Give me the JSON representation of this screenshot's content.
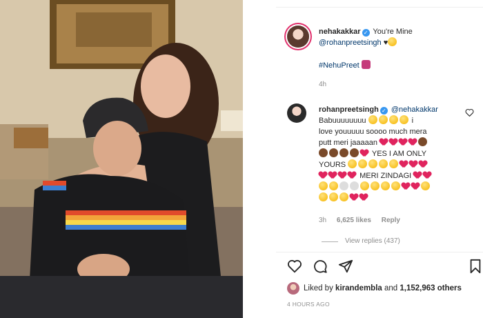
{
  "post": {
    "author": "nehakakkar",
    "caption": "You're Mine",
    "mention": "@rohanpreetsingh",
    "hashtag": "#NehuPreet",
    "time": "4h"
  },
  "comment": {
    "author": "rohanpreetsingh",
    "mention": "@nehakakkar",
    "line1": "Babuuuuuuuu",
    "line2": "i",
    "line3": "love youuuuu soooo much mera",
    "line4": "putt meri jaaaaan",
    "line5": "YES I AM ONLY",
    "line6": "YOURS",
    "line7": "MERI ZINDAGI",
    "time": "3h",
    "likes": "6,625 likes",
    "reply": "Reply",
    "view_replies": "View replies (437)"
  },
  "footer": {
    "liked_prefix": "Liked by",
    "liked_user": "kirandembla",
    "liked_and": "and",
    "liked_count": "1,152,963 others",
    "timestamp": "4 HOURS AGO"
  },
  "icons": {
    "heart": "heart-icon",
    "comment": "comment-icon",
    "share": "share-icon",
    "bookmark": "bookmark-icon"
  }
}
